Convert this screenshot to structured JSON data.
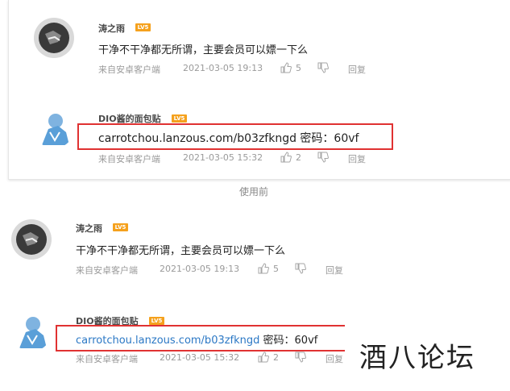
{
  "caption": "使用前",
  "watermark": "酒八论坛",
  "level_badge": "LV5",
  "panels": [
    {
      "comments": [
        {
          "username": "涛之雨",
          "text": "干净不干净都无所谓，主要会员可以嫖一下么",
          "source": "来自安卓客户端",
          "time": "2021-03-05 19:13",
          "likes": "5",
          "reply": "回复"
        },
        {
          "username": "DIO酱的面包贴",
          "link": "carrotchou.lanzous.com/b03zfkngd",
          "text_suffix": " 密码：60vf",
          "source": "来自安卓客户端",
          "time": "2021-03-05 15:32",
          "likes": "2",
          "reply": "回复"
        }
      ]
    },
    {
      "comments": [
        {
          "username": "涛之雨",
          "text": "干净不干净都无所谓，主要会员可以嫖一下么",
          "source": "来自安卓客户端",
          "time": "2021-03-05 19:13",
          "likes": "5",
          "reply": "回复"
        },
        {
          "username": "DIO酱的面包贴",
          "link": "carrotchou.lanzous.com/b03zfkngd",
          "text_suffix": " 密码：60vf",
          "source": "来自安卓客户端",
          "time": "2021-03-05 15:32",
          "likes": "2",
          "reply": "回复"
        }
      ]
    }
  ],
  "colors": {
    "link": "#2b78c5",
    "badge": "#f5a11d",
    "highlight_box": "#e03232",
    "meta_text": "#9a9a9a"
  }
}
